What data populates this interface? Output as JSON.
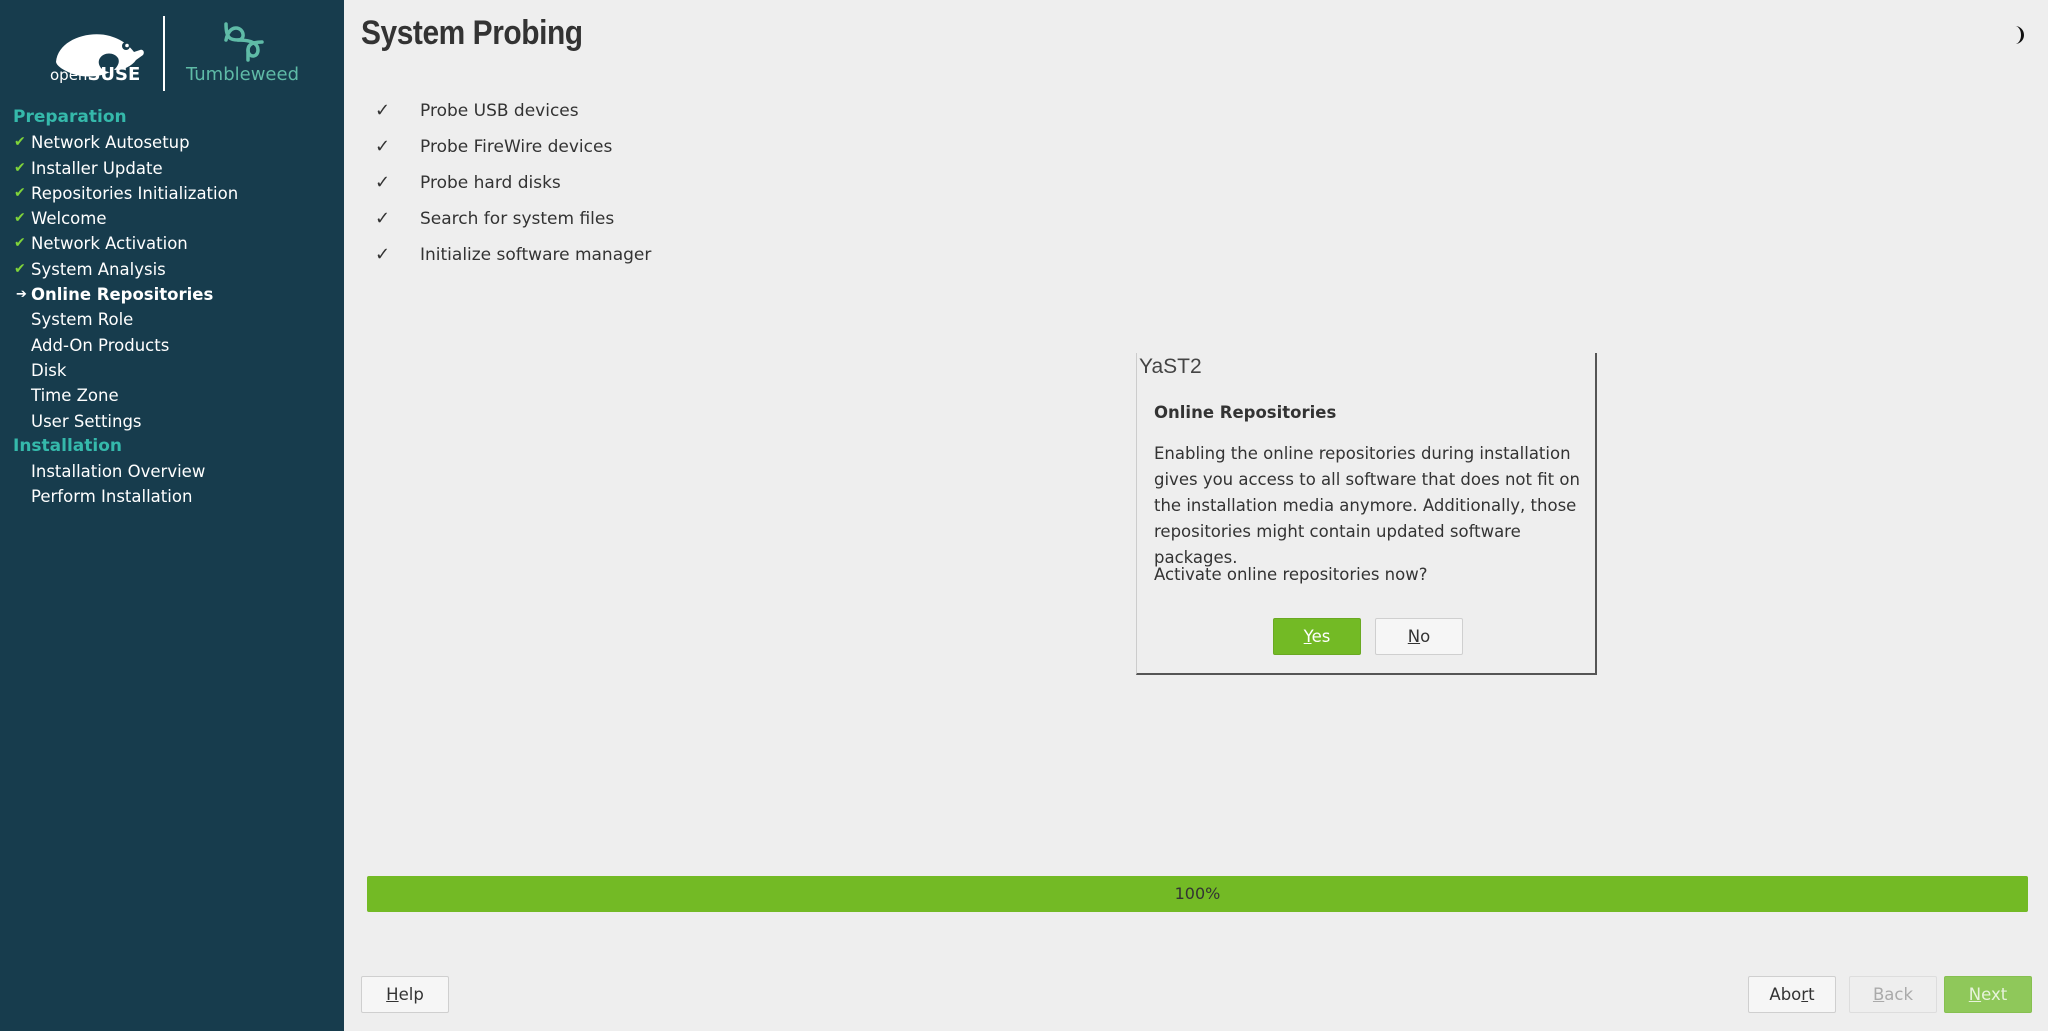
{
  "branding": {
    "left_logo_prefix": "open",
    "left_logo_bold": "SUSE",
    "right_logo_text": "Tumbleweed"
  },
  "colors": {
    "sidebar_bg": "#173c4d",
    "section_title": "#35b9ab",
    "accent_green": "#73ba25",
    "check_green": "#7fd33a",
    "tumbleweed_teal": "#5fbba7"
  },
  "sidebar": {
    "sections": [
      {
        "title": "Preparation",
        "items": [
          {
            "label": "Network Autosetup",
            "state": "done"
          },
          {
            "label": "Installer Update",
            "state": "done"
          },
          {
            "label": "Repositories Initialization",
            "state": "done"
          },
          {
            "label": "Welcome",
            "state": "done"
          },
          {
            "label": "Network Activation",
            "state": "done"
          },
          {
            "label": "System Analysis",
            "state": "done"
          },
          {
            "label": "Online Repositories",
            "state": "current"
          },
          {
            "label": "System Role",
            "state": "pending"
          },
          {
            "label": "Add-On Products",
            "state": "pending"
          },
          {
            "label": "Disk",
            "state": "pending"
          },
          {
            "label": "Time Zone",
            "state": "pending"
          },
          {
            "label": "User Settings",
            "state": "pending"
          }
        ]
      },
      {
        "title": "Installation",
        "items": [
          {
            "label": "Installation Overview",
            "state": "pending"
          },
          {
            "label": "Perform Installation",
            "state": "pending"
          }
        ]
      }
    ],
    "done_mark": "✔",
    "current_mark": "➔"
  },
  "main": {
    "title": "System Probing",
    "theme_icon": "half-moon-icon",
    "probe_mark": "✓",
    "probe_items": [
      "Probe USB devices",
      "Probe FireWire devices",
      "Probe hard disks",
      "Search for system files",
      "Initialize software manager"
    ],
    "progress": {
      "percent": 100,
      "label": "100%"
    }
  },
  "dialog": {
    "window_title": "YaST2",
    "heading": "Online Repositories",
    "body_lines": [
      "Enabling the online repositories during installation",
      "gives you access to all software that does not fit on",
      "the installation media anymore. Additionally, those",
      "repositories might contain updated software packages."
    ],
    "question": "Activate online repositories now?",
    "yes": {
      "underlined": "Y",
      "rest": "es"
    },
    "no": {
      "underlined": "N",
      "rest": "o"
    }
  },
  "footer": {
    "help": {
      "underlined": "H",
      "rest": "elp"
    },
    "abort": {
      "before": "Abo",
      "underlined": "r",
      "after": "t"
    },
    "back": {
      "underlined": "B",
      "rest": "ack"
    },
    "next": {
      "underlined": "N",
      "rest": "ext"
    }
  }
}
